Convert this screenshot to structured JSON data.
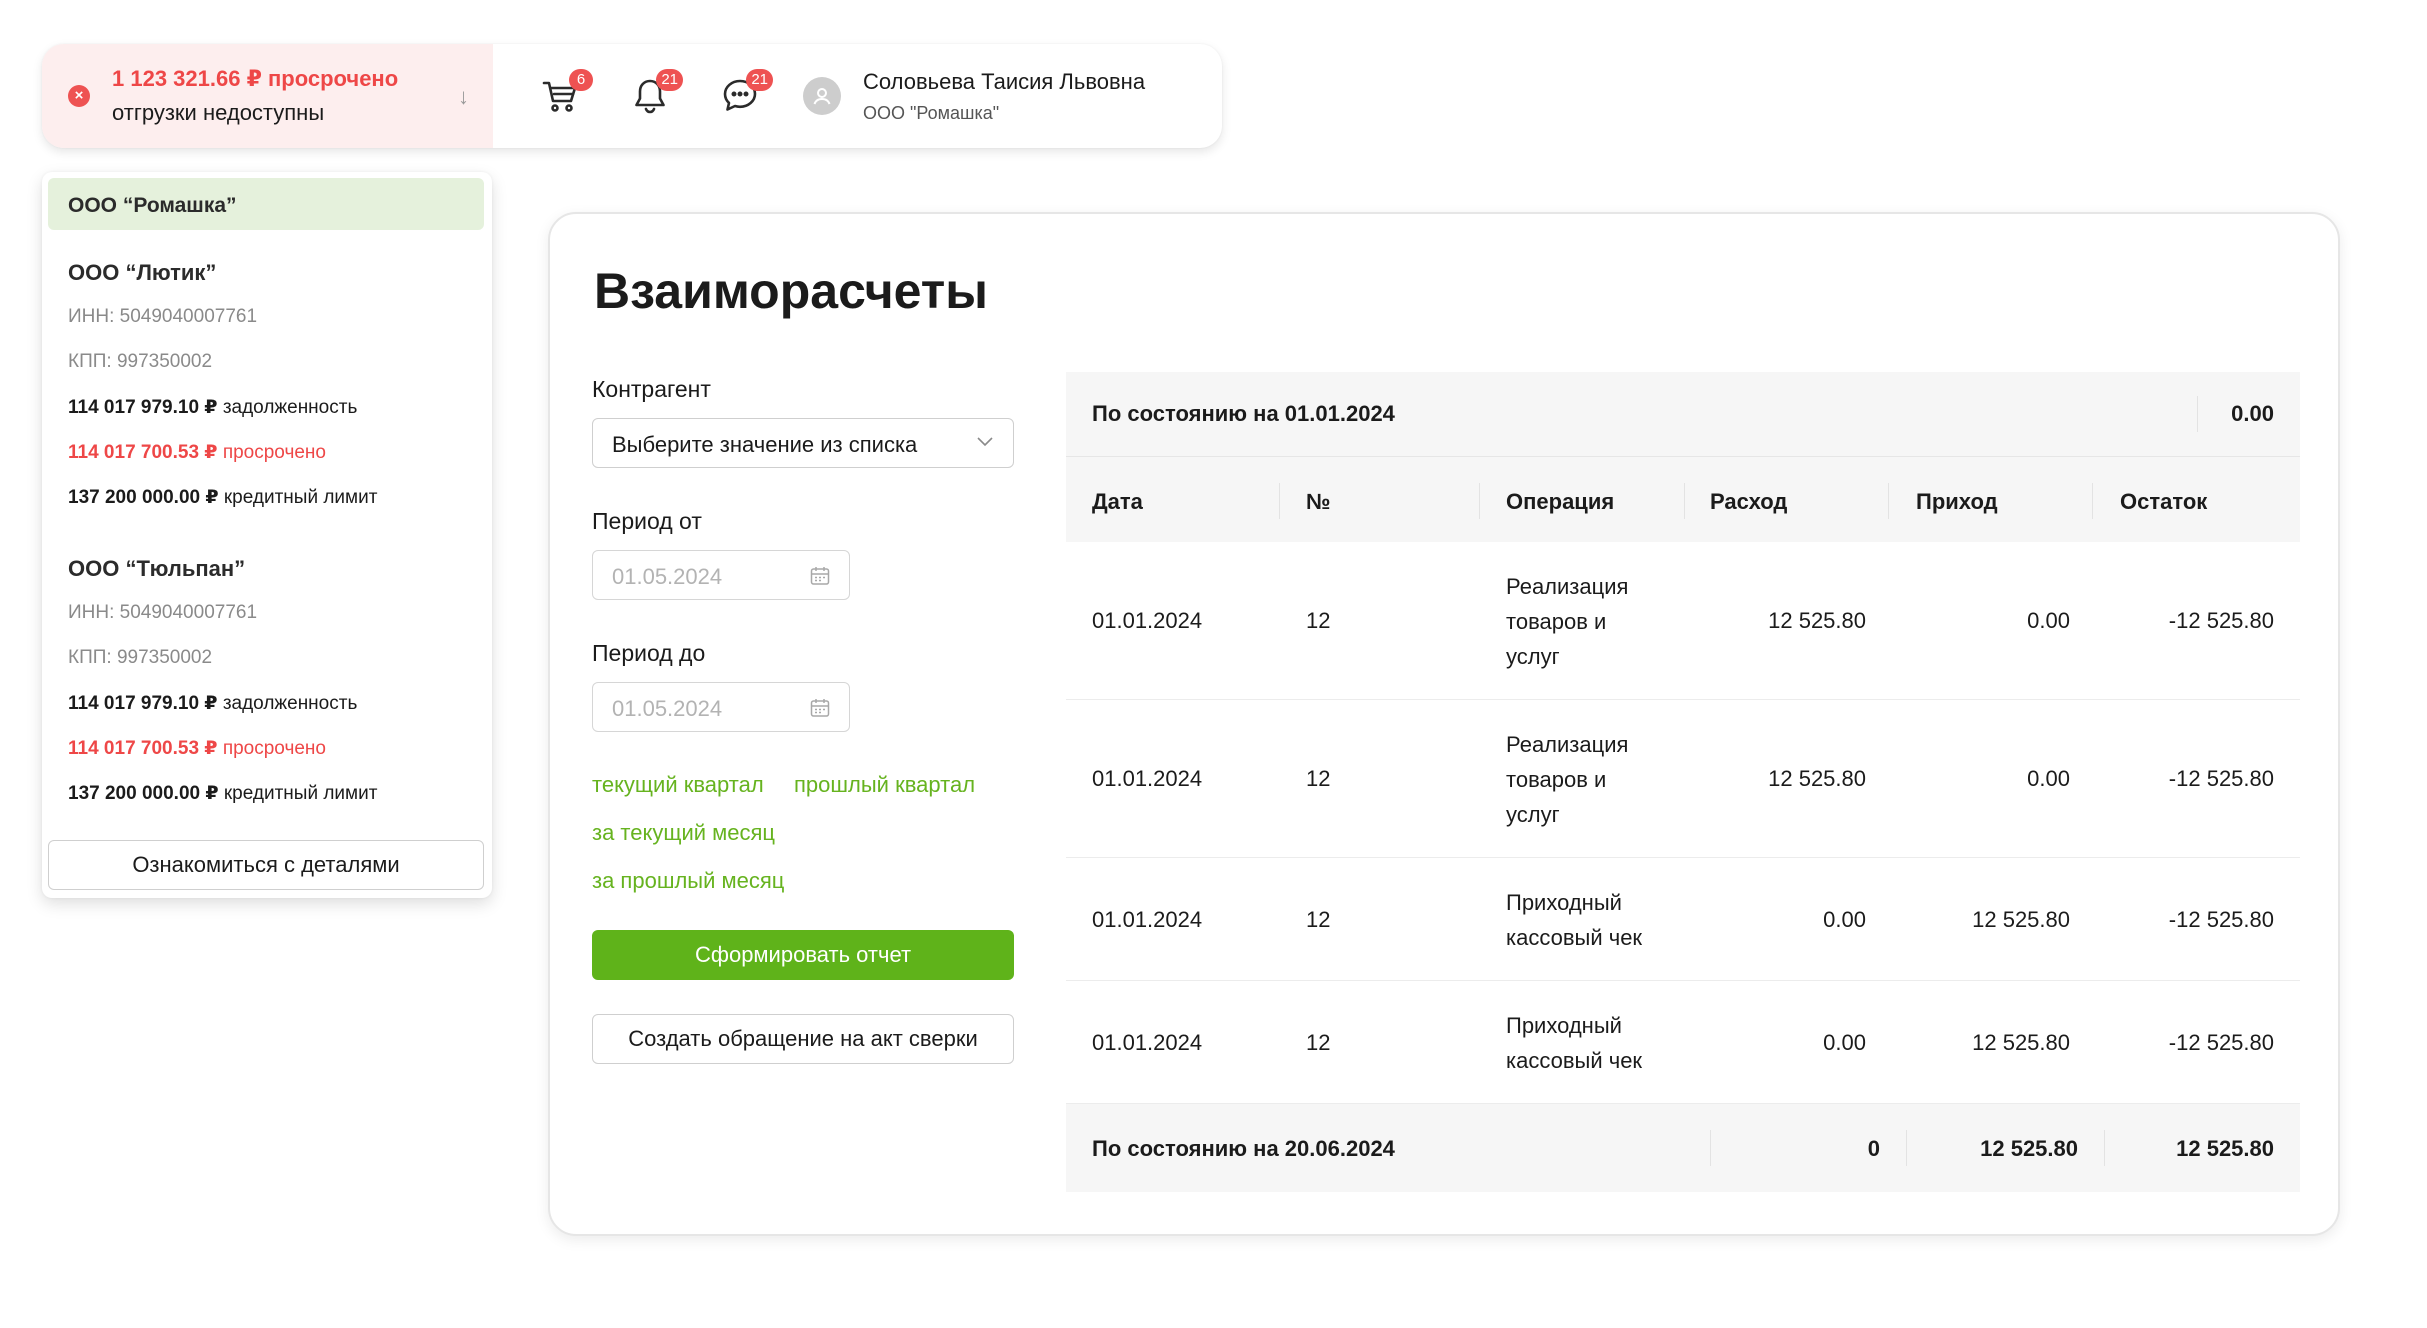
{
  "header": {
    "alert": {
      "amount": "1 123 321.66 ₽ просрочено",
      "subtitle": "отгрузки недоступны"
    },
    "cart_badge": "6",
    "notifications_badge": "21",
    "messages_badge": "21",
    "user": {
      "name": "Соловьева Таисия Львовна",
      "org": "ООО \"Ромашка\""
    }
  },
  "org_panel": {
    "active": "ООО “Ромашка”",
    "orgs": [
      {
        "name": "ООО “Лютик”",
        "inn": "ИНН: 5049040007761",
        "kpp": "КПП: 997350002",
        "debt_amount": "114 017 979.10 ₽",
        "debt_label": "задолженность",
        "overdue_amount": "114 017 700.53 ₽",
        "overdue_label": "просрочено",
        "limit_amount": "137 200 000.00 ₽",
        "limit_label": "кредитный лимит"
      },
      {
        "name": "ООО “Тюльпан”",
        "inn": "ИНН: 5049040007761",
        "kpp": "КПП: 997350002",
        "debt_amount": "114 017 979.10 ₽",
        "debt_label": "задолженность",
        "overdue_amount": "114 017 700.53 ₽",
        "overdue_label": "просрочено",
        "limit_amount": "137 200 000.00 ₽",
        "limit_label": "кредитный лимит"
      }
    ],
    "details_button": "Ознакомиться с деталями"
  },
  "main": {
    "title": "Взаиморасчеты",
    "counterparty_label": "Контрагент",
    "counterparty_placeholder": "Выберите значение из списка",
    "period_from_label": "Период от",
    "period_from_value": "01.05.2024",
    "period_to_label": "Период до",
    "period_to_value": "01.05.2024",
    "quick_links": {
      "current_quarter": "текущий квартал",
      "previous_quarter": "прошлый квартал",
      "current_month": "за текущий месяц",
      "previous_month": "за прошлый месяц"
    },
    "generate_button": "Сформировать отчет",
    "reconciliation_button": "Создать обращение на акт сверки"
  },
  "table": {
    "opening_label": "По состоянию на 01.01.2024",
    "opening_value": "0.00",
    "columns": [
      "Дата",
      "№",
      "Операция",
      "Расход",
      "Приход",
      "Остаток"
    ],
    "rows": [
      {
        "date": "01.01.2024",
        "num": "12",
        "op_lines": [
          "Реализация",
          "товаров и",
          "услуг"
        ],
        "expense": "12 525.80",
        "income": "0.00",
        "balance": "-12 525.80"
      },
      {
        "date": "01.01.2024",
        "num": "12",
        "op_lines": [
          "Реализация",
          "товаров и",
          "услуг"
        ],
        "expense": "12 525.80",
        "income": "0.00",
        "balance": "-12 525.80"
      },
      {
        "date": "01.01.2024",
        "num": "12",
        "op_lines": [
          "Приходный",
          "кассовый чек"
        ],
        "expense": "0.00",
        "income": "12 525.80",
        "balance": "-12 525.80"
      },
      {
        "date": "01.01.2024",
        "num": "12",
        "op_lines": [
          "Приходный",
          "кассовый чек"
        ],
        "expense": "0.00",
        "income": "12 525.80",
        "balance": "-12 525.80"
      }
    ],
    "closing_label": "По состоянию на 20.06.2024",
    "closing_expense": "0",
    "closing_income": "12 525.80",
    "closing_balance": "12 525.80"
  },
  "colors": {
    "accent_green": "#5fb31a",
    "link_green": "#66b31f",
    "alert_red": "#ee4747",
    "alert_bg": "#fdeeee",
    "active_org_bg": "#e5f1dc"
  },
  "icons": [
    "close-circle-icon",
    "arrow-down-icon",
    "cart-icon",
    "bell-icon",
    "chat-icon",
    "user-avatar-icon",
    "chevron-down-icon",
    "calendar-icon"
  ]
}
